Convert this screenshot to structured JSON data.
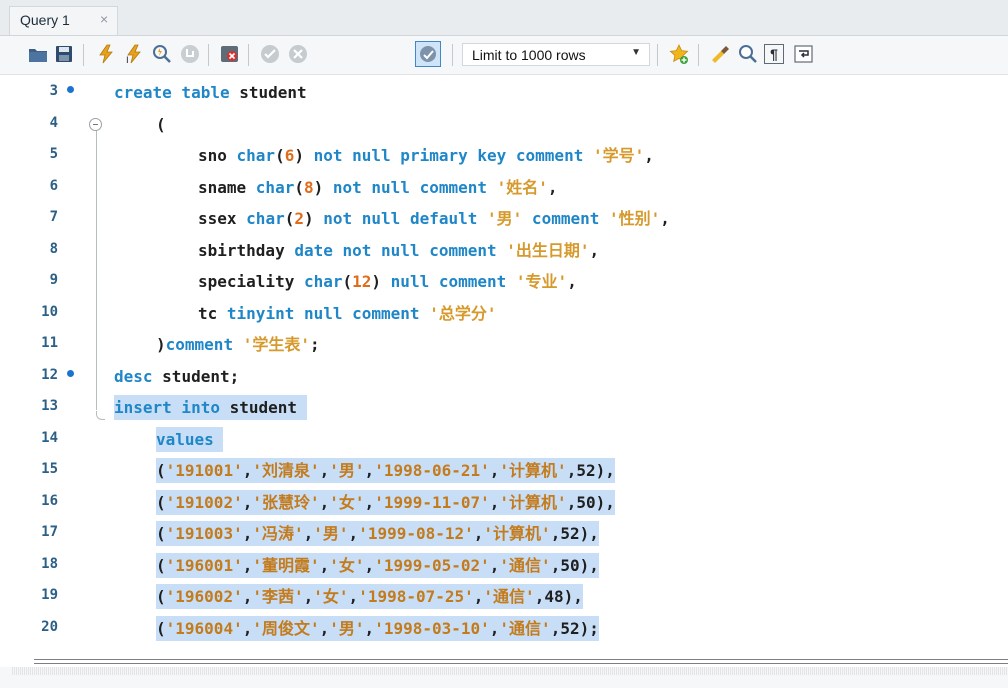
{
  "tabs": [
    {
      "label": "Query 1",
      "close": "×",
      "active": true
    }
  ],
  "toolbar": {
    "buttons": [
      {
        "icon": "folder-open-icon",
        "label": ""
      },
      {
        "icon": "save-icon",
        "label": ""
      },
      {
        "icon": "execute-icon",
        "label": ""
      },
      {
        "icon": "execute-current-icon",
        "label": ""
      },
      {
        "icon": "explain-icon",
        "label": ""
      },
      {
        "icon": "stop-icon",
        "label": ""
      },
      {
        "icon": "toggle-error-icon",
        "label": ""
      },
      {
        "icon": "commit-icon",
        "label": ""
      },
      {
        "icon": "rollback-icon",
        "label": ""
      },
      {
        "icon": "autocommit-icon",
        "label": "",
        "active": true
      },
      {
        "icon": "bookmark-star-icon",
        "label": ""
      },
      {
        "icon": "beautify-icon",
        "label": ""
      },
      {
        "icon": "find-icon",
        "label": ""
      },
      {
        "icon": "invisible-chars-icon",
        "label": "¶"
      },
      {
        "icon": "word-wrap-icon",
        "label": ""
      }
    ],
    "limit_select": {
      "value": "Limit to 1000 rows",
      "arrow": "▼"
    }
  },
  "editor": {
    "lines": [
      {
        "num": "3",
        "marker": true,
        "indent": 0,
        "tokens": [
          {
            "t": "create table ",
            "c": "kw"
          },
          {
            "t": "student",
            "c": "plain"
          }
        ]
      },
      {
        "num": "4",
        "marker": false,
        "indent": 1,
        "tokens": [
          {
            "t": "(",
            "c": "plain"
          }
        ]
      },
      {
        "num": "5",
        "marker": false,
        "indent": 2,
        "tokens": [
          {
            "t": "sno ",
            "c": "plain"
          },
          {
            "t": "char",
            "c": "kw"
          },
          {
            "t": "(",
            "c": "plain"
          },
          {
            "t": "6",
            "c": "num"
          },
          {
            "t": ") ",
            "c": "plain"
          },
          {
            "t": "not null primary key comment ",
            "c": "kw"
          },
          {
            "t": "'学号'",
            "c": "str"
          },
          {
            "t": ",",
            "c": "plain"
          }
        ]
      },
      {
        "num": "6",
        "marker": false,
        "indent": 2,
        "tokens": [
          {
            "t": "sname ",
            "c": "plain"
          },
          {
            "t": "char",
            "c": "kw"
          },
          {
            "t": "(",
            "c": "plain"
          },
          {
            "t": "8",
            "c": "num"
          },
          {
            "t": ") ",
            "c": "plain"
          },
          {
            "t": "not null comment ",
            "c": "kw"
          },
          {
            "t": "'姓名'",
            "c": "str"
          },
          {
            "t": ",",
            "c": "plain"
          }
        ]
      },
      {
        "num": "7",
        "marker": false,
        "indent": 2,
        "tokens": [
          {
            "t": "ssex ",
            "c": "plain"
          },
          {
            "t": "char",
            "c": "kw"
          },
          {
            "t": "(",
            "c": "plain"
          },
          {
            "t": "2",
            "c": "num"
          },
          {
            "t": ") ",
            "c": "plain"
          },
          {
            "t": "not null default ",
            "c": "kw"
          },
          {
            "t": "'男'",
            "c": "str"
          },
          {
            "t": " comment ",
            "c": "kw"
          },
          {
            "t": "'性别'",
            "c": "str"
          },
          {
            "t": ",",
            "c": "plain"
          }
        ]
      },
      {
        "num": "8",
        "marker": false,
        "indent": 2,
        "tokens": [
          {
            "t": "sbirthday ",
            "c": "plain"
          },
          {
            "t": "date not null comment ",
            "c": "kw"
          },
          {
            "t": "'出生日期'",
            "c": "str"
          },
          {
            "t": ",",
            "c": "plain"
          }
        ]
      },
      {
        "num": "9",
        "marker": false,
        "indent": 2,
        "tokens": [
          {
            "t": "speciality ",
            "c": "plain"
          },
          {
            "t": "char",
            "c": "kw"
          },
          {
            "t": "(",
            "c": "plain"
          },
          {
            "t": "12",
            "c": "num"
          },
          {
            "t": ") ",
            "c": "plain"
          },
          {
            "t": "null comment ",
            "c": "kw"
          },
          {
            "t": "'专业'",
            "c": "str"
          },
          {
            "t": ",",
            "c": "plain"
          }
        ]
      },
      {
        "num": "10",
        "marker": false,
        "indent": 2,
        "tokens": [
          {
            "t": "tc ",
            "c": "plain"
          },
          {
            "t": "tinyint null comment ",
            "c": "kw"
          },
          {
            "t": "'总学分'",
            "c": "str"
          }
        ]
      },
      {
        "num": "11",
        "marker": false,
        "indent": 1,
        "tokens": [
          {
            "t": ")",
            "c": "plain"
          },
          {
            "t": "comment ",
            "c": "kw"
          },
          {
            "t": "'学生表'",
            "c": "str"
          },
          {
            "t": ";",
            "c": "plain"
          }
        ]
      },
      {
        "num": "12",
        "marker": true,
        "indent": 0,
        "tokens": [
          {
            "t": "desc ",
            "c": "kw"
          },
          {
            "t": "student;",
            "c": "plain"
          }
        ]
      },
      {
        "num": "13",
        "marker": false,
        "indent": 0,
        "selected": true,
        "tokens": [
          {
            "t": "insert into ",
            "c": "kw"
          },
          {
            "t": "student ",
            "c": "plain"
          }
        ]
      },
      {
        "num": "14",
        "marker": false,
        "indent": 1,
        "selected": true,
        "tokens": [
          {
            "t": "values ",
            "c": "kw"
          }
        ]
      },
      {
        "num": "15",
        "marker": false,
        "indent": 1,
        "selected": true,
        "tokens": [
          {
            "t": "(",
            "c": "plain"
          },
          {
            "t": "'191001'",
            "c": "str-sel"
          },
          {
            "t": ",",
            "c": "plain"
          },
          {
            "t": "'刘清泉'",
            "c": "str-sel"
          },
          {
            "t": ",",
            "c": "plain"
          },
          {
            "t": "'男'",
            "c": "str-sel"
          },
          {
            "t": ",",
            "c": "plain"
          },
          {
            "t": "'1998-06-21'",
            "c": "str-sel"
          },
          {
            "t": ",",
            "c": "plain"
          },
          {
            "t": "'计算机'",
            "c": "str-sel"
          },
          {
            "t": ",52),",
            "c": "plain"
          }
        ]
      },
      {
        "num": "16",
        "marker": false,
        "indent": 1,
        "selected": true,
        "tokens": [
          {
            "t": "(",
            "c": "plain"
          },
          {
            "t": "'191002'",
            "c": "str-sel"
          },
          {
            "t": ",",
            "c": "plain"
          },
          {
            "t": "'张慧玲'",
            "c": "str-sel"
          },
          {
            "t": ",",
            "c": "plain"
          },
          {
            "t": "'女'",
            "c": "str-sel"
          },
          {
            "t": ",",
            "c": "plain"
          },
          {
            "t": "'1999-11-07'",
            "c": "str-sel"
          },
          {
            "t": ",",
            "c": "plain"
          },
          {
            "t": "'计算机'",
            "c": "str-sel"
          },
          {
            "t": ",50),",
            "c": "plain"
          }
        ]
      },
      {
        "num": "17",
        "marker": false,
        "indent": 1,
        "selected": true,
        "tokens": [
          {
            "t": "(",
            "c": "plain"
          },
          {
            "t": "'191003'",
            "c": "str-sel"
          },
          {
            "t": ",",
            "c": "plain"
          },
          {
            "t": "'冯涛'",
            "c": "str-sel"
          },
          {
            "t": ",",
            "c": "plain"
          },
          {
            "t": "'男'",
            "c": "str-sel"
          },
          {
            "t": ",",
            "c": "plain"
          },
          {
            "t": "'1999-08-12'",
            "c": "str-sel"
          },
          {
            "t": ",",
            "c": "plain"
          },
          {
            "t": "'计算机'",
            "c": "str-sel"
          },
          {
            "t": ",52),",
            "c": "plain"
          }
        ]
      },
      {
        "num": "18",
        "marker": false,
        "indent": 1,
        "selected": true,
        "tokens": [
          {
            "t": "(",
            "c": "plain"
          },
          {
            "t": "'196001'",
            "c": "str-sel"
          },
          {
            "t": ",",
            "c": "plain"
          },
          {
            "t": "'董明霞'",
            "c": "str-sel"
          },
          {
            "t": ",",
            "c": "plain"
          },
          {
            "t": "'女'",
            "c": "str-sel"
          },
          {
            "t": ",",
            "c": "plain"
          },
          {
            "t": "'1999-05-02'",
            "c": "str-sel"
          },
          {
            "t": ",",
            "c": "plain"
          },
          {
            "t": "'通信'",
            "c": "str-sel"
          },
          {
            "t": ",50),",
            "c": "plain"
          }
        ]
      },
      {
        "num": "19",
        "marker": false,
        "indent": 1,
        "selected": true,
        "tokens": [
          {
            "t": "(",
            "c": "plain"
          },
          {
            "t": "'196002'",
            "c": "str-sel"
          },
          {
            "t": ",",
            "c": "plain"
          },
          {
            "t": "'李茜'",
            "c": "str-sel"
          },
          {
            "t": ",",
            "c": "plain"
          },
          {
            "t": "'女'",
            "c": "str-sel"
          },
          {
            "t": ",",
            "c": "plain"
          },
          {
            "t": "'1998-07-25'",
            "c": "str-sel"
          },
          {
            "t": ",",
            "c": "plain"
          },
          {
            "t": "'通信'",
            "c": "str-sel"
          },
          {
            "t": ",48),",
            "c": "plain"
          }
        ]
      },
      {
        "num": "20",
        "marker": false,
        "indent": 1,
        "selected": true,
        "tokens": [
          {
            "t": "(",
            "c": "plain"
          },
          {
            "t": "'196004'",
            "c": "str-sel"
          },
          {
            "t": ",",
            "c": "plain"
          },
          {
            "t": "'周俊文'",
            "c": "str-sel"
          },
          {
            "t": ",",
            "c": "plain"
          },
          {
            "t": "'男'",
            "c": "str-sel"
          },
          {
            "t": ",",
            "c": "plain"
          },
          {
            "t": "'1998-03-10'",
            "c": "str-sel"
          },
          {
            "t": ",",
            "c": "plain"
          },
          {
            "t": "'通信'",
            "c": "str-sel"
          },
          {
            "t": ",52);",
            "c": "plain"
          }
        ]
      }
    ]
  },
  "colors": {
    "keyword": "#1f86c8",
    "number": "#e06b1a",
    "string": "#d69a2c",
    "selection": "#c7def6",
    "line_number": "#2b5f86",
    "marker": "#1a73d1"
  }
}
